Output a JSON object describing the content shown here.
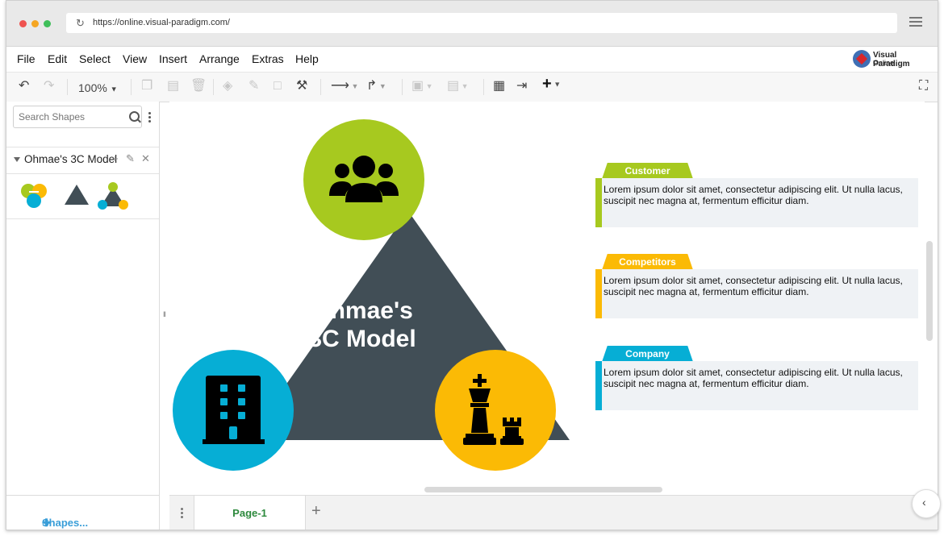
{
  "browser": {
    "url": "https://online.visual-paradigm.com/"
  },
  "menubar": {
    "items": [
      "File",
      "Edit",
      "Select",
      "View",
      "Insert",
      "Arrange",
      "Extras",
      "Help"
    ]
  },
  "brand": {
    "line1": "Visual Paradigm",
    "line2": "Online"
  },
  "toolbar": {
    "zoom": "100%"
  },
  "sidebar": {
    "search_placeholder": "Search Shapes",
    "library_name": "Ohmae's 3C Model",
    "shapes_link": "Shapes..."
  },
  "diagram": {
    "title_line1": "Ohmae's",
    "title_line2": "3C Model",
    "colors": {
      "green": "#a7c91f",
      "blue": "#06aed5",
      "yellow": "#fbba05",
      "triangle": "#414e56",
      "card": "#eff2f5"
    },
    "cards": [
      {
        "tag": "Customer",
        "text": "Lorem ipsum dolor sit amet, consectetur adipiscing elit. Ut nulla lacus, suscipit nec magna at, fermentum efficitur diam."
      },
      {
        "tag": "Competitors",
        "text": "Lorem ipsum dolor sit amet, consectetur adipiscing elit. Ut nulla lacus, suscipit nec magna at, fermentum efficitur diam."
      },
      {
        "tag": "Company",
        "text": "Lorem ipsum dolor sit amet, consectetur adipiscing elit. Ut nulla lacus, suscipit nec magna at, fermentum efficitur diam."
      }
    ]
  },
  "pages": {
    "active": "Page-1"
  }
}
